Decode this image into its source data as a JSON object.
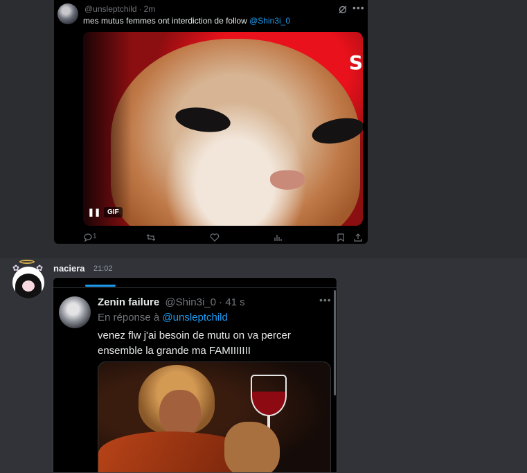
{
  "embed_top": {
    "handle": "@unsleptchild",
    "age": "2m",
    "text": "mes mutus femmes ont interdiction de follow",
    "mention": "@Shin3i_0",
    "gif_badge": "GIF",
    "actions": {
      "replies": "1"
    }
  },
  "message": {
    "author": "naciera",
    "time": "21:02",
    "embed": {
      "display_name": "Zenin failure",
      "handle": "@Shin3i_0",
      "age": "41 s",
      "reply_prefix": "En réponse à",
      "reply_to": "@unsleptchild",
      "body": "venez flw j'ai besoin de mutu on va percer ensemble la grande ma FAMIIIIIII"
    }
  },
  "colors": {
    "background": "#313338",
    "embed_bg": "#000000",
    "mention": "#1d9bf0",
    "muted": "#71767b"
  },
  "icons": [
    "grok-icon",
    "more-icon",
    "pause-icon",
    "reply-icon",
    "retweet-icon",
    "like-icon",
    "views-icon",
    "bookmark-icon",
    "share-icon",
    "halo-icon",
    "flower-icon"
  ]
}
